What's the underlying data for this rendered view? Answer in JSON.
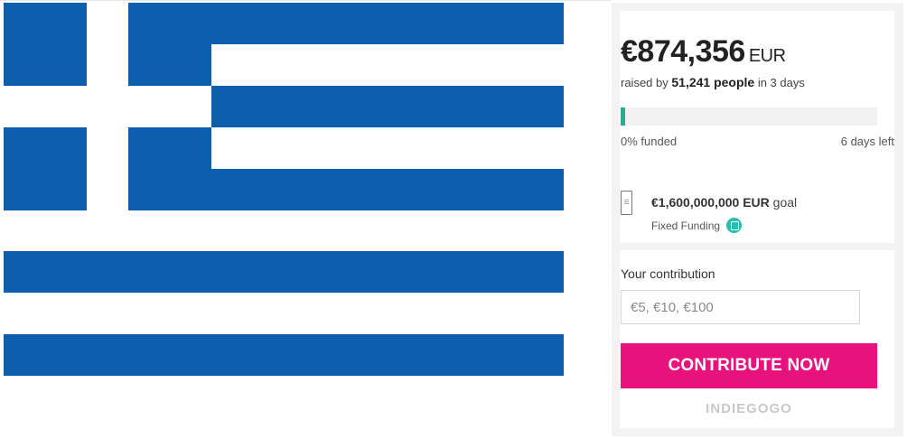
{
  "flag": {
    "name": "greek-flag",
    "blue": "#0d5eaf",
    "white": "#ffffff"
  },
  "campaign": {
    "raised_amount": "€874,356",
    "raised_currency": "EUR",
    "raised_by_prefix": "raised by",
    "people_count": "51,241 people",
    "raised_suffix": "in 3 days",
    "progress_percent": 0,
    "funded_label": "0% funded",
    "days_left": "6 days left",
    "goal_amount": "€1,600,000,000",
    "goal_currency": "EUR",
    "goal_suffix": "goal",
    "funding_type": "Fixed Funding"
  },
  "contribution": {
    "label": "Your contribution",
    "placeholder": "€5, €10, €100",
    "button_label": "CONTRIBUTE NOW"
  },
  "brand": "INDIEGOGO",
  "colors": {
    "accent_pink": "#e8127d",
    "progress_green": "#1fb08e",
    "info_teal": "#2bbdb1"
  }
}
